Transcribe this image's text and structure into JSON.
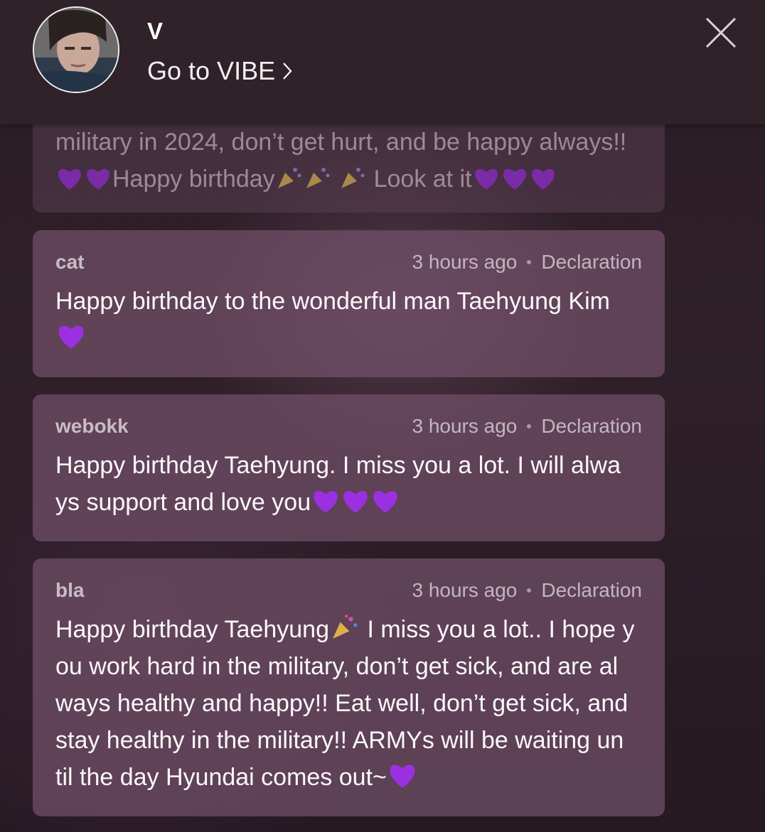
{
  "header": {
    "name": "V",
    "link_label": "Go to VIBE",
    "avatar": "profile-photo"
  },
  "comments": [
    {
      "author": "",
      "time": "",
      "action": "",
      "lines": [
        "military in 2024, don’t get hurt, and be happy always!!",
        "Happy birthday",
        "Look at it"
      ]
    },
    {
      "author": "cat",
      "time": "3 hours ago",
      "action": "Declaration",
      "lines": [
        "Happy birthday to the wonderful man Taehyung Kim"
      ]
    },
    {
      "author": "webokk",
      "time": "3 hours ago",
      "action": "Declaration",
      "lines": [
        "Happy birthday Taehyung. I miss you a lot. I will alwa",
        "ys support and love you"
      ]
    },
    {
      "author": "bla",
      "time": "3 hours ago",
      "action": "Declaration",
      "lines": [
        "Happy birthday Taehyung",
        "I miss you a lot.. I hope y",
        "ou work hard in the military, don’t get sick, and are al",
        "ways healthy and happy!! Eat well, don’t get sick, and",
        "stay healthy in the military!! ARMYs will be waiting un",
        "til the day Hyundai comes out~"
      ]
    }
  ],
  "colors": {
    "heart": "#9b30e0",
    "card": "#73506a",
    "header": "#2f2229"
  }
}
